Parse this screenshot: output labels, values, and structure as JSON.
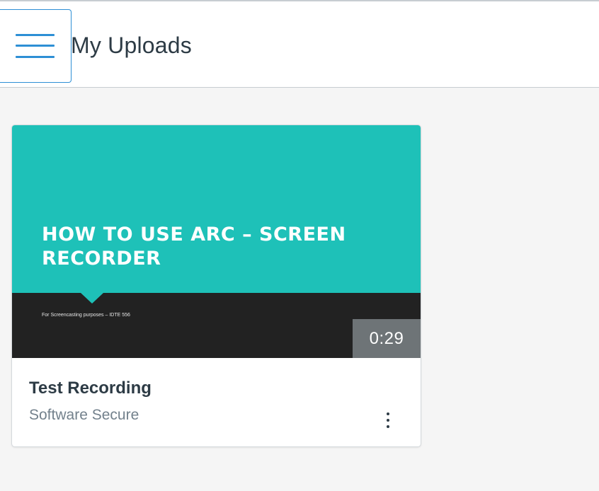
{
  "header": {
    "menu_icon": "hamburger-icon",
    "title": "My Uploads"
  },
  "uploads": [
    {
      "title": "Test Recording",
      "owner": "Software Secure",
      "duration": "0:29",
      "thumbnail": {
        "title": "HOW TO USE ARC – SCREEN RECORDER",
        "subtitle": "For Screencasting purposes – IDTE 556"
      },
      "options_icon": "kebab-menu-icon"
    }
  ],
  "colors": {
    "accent": "#2d8fd5",
    "thumbnail_bg": "#1ec1b8",
    "thumbnail_band": "#222222",
    "badge_bg": "#6e7477",
    "text_primary": "#2d3b45",
    "text_secondary": "#73818c"
  }
}
